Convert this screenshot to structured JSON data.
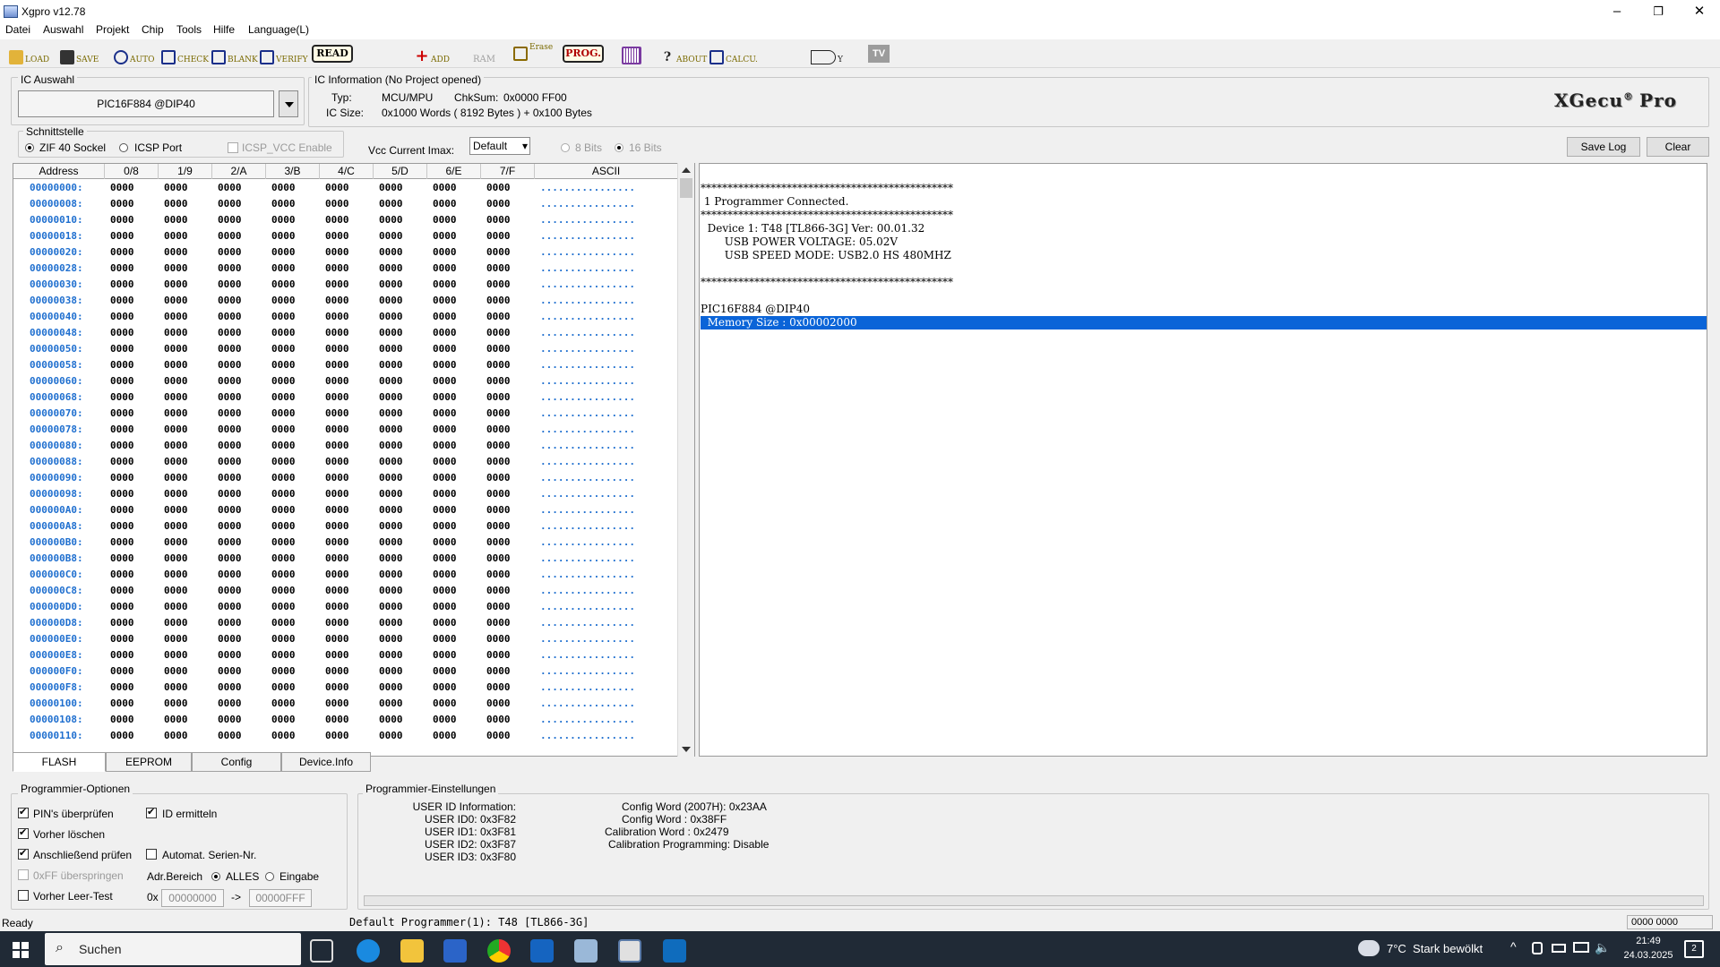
{
  "window": {
    "title": "Xgpro v12.78",
    "minimize": "–",
    "maximize": "❐",
    "close": "✕"
  },
  "menu": [
    "Datei",
    "Auswahl",
    "Projekt",
    "Chip",
    "Tools",
    "Hilfe",
    "Language(L)"
  ],
  "toolbar": {
    "load": "LOAD",
    "save": "SAVE",
    "auto": "AUTO",
    "check": "CHECK",
    "blank": "BLANK",
    "verify": "VERIFY",
    "read": "READ",
    "add": "ADD",
    "ram": "RAM",
    "erase": "Erase",
    "prog": "PROG.",
    "about": "ABOUT",
    "calcu": "CALCU.",
    "tv": "TV",
    "bxy": "Y"
  },
  "ic_auswahl": {
    "title": "IC Auswahl",
    "selected": "PIC16F884 @DIP40"
  },
  "ic_info": {
    "title": "IC Information (No Project opened)",
    "typ_label": "Typ:",
    "typ_value": "MCU/MPU",
    "chksum_label": "ChkSum:",
    "chksum_value": "0x0000 FF00",
    "size_label": "IC Size:",
    "size_value": "0x1000 Words ( 8192 Bytes ) + 0x100 Bytes"
  },
  "logo": {
    "text": "XGecu",
    "suffix": "Pro",
    "mark": "®"
  },
  "schnittstelle": {
    "title": "Schnittstelle",
    "zif": "ZIF 40 Sockel",
    "icsp": "ICSP Port",
    "icsp_vcc": "ICSP_VCC Enable"
  },
  "vcc": {
    "label": "Vcc Current Imax:",
    "value": "Default",
    "bits8": "8 Bits",
    "bits16": "16 Bits"
  },
  "log_buttons": {
    "save": "Save Log",
    "clear": "Clear"
  },
  "hex": {
    "headers": [
      "Address",
      "0/8",
      "1/9",
      "2/A",
      "3/B",
      "4/C",
      "5/D",
      "6/E",
      "7/F",
      "ASCII"
    ],
    "cell": "0000",
    "ascii": "................",
    "addresses": [
      "00000000:",
      "00000008:",
      "00000010:",
      "00000018:",
      "00000020:",
      "00000028:",
      "00000030:",
      "00000038:",
      "00000040:",
      "00000048:",
      "00000050:",
      "00000058:",
      "00000060:",
      "00000068:",
      "00000070:",
      "00000078:",
      "00000080:",
      "00000088:",
      "00000090:",
      "00000098:",
      "000000A0:",
      "000000A8:",
      "000000B0:",
      "000000B8:",
      "000000C0:",
      "000000C8:",
      "000000D0:",
      "000000D8:",
      "000000E0:",
      "000000E8:",
      "000000F0:",
      "000000F8:",
      "00000100:",
      "00000108:",
      "00000110:"
    ]
  },
  "log": [
    "***********************************************",
    " 1 Programmer Connected.",
    "***********************************************",
    "  Device 1: T48 [TL866-3G] Ver: 00.01.32",
    "       USB POWER VOLTAGE: 05.02V",
    "       USB SPEED MODE: USB2.0 HS 480MHZ",
    "",
    "***********************************************",
    "",
    "PIC16F884 @DIP40",
    "  Memory Size : 0x00002000"
  ],
  "tabs": [
    "FLASH",
    "EEPROM",
    "Config",
    "Device.Info"
  ],
  "prog_opts": {
    "title": "Programmier-Optionen",
    "pins": "PIN's überprüfen",
    "id": "ID ermitteln",
    "vorher_loeschen": "Vorher löschen",
    "anschl": "Anschließend prüfen",
    "serien": "Automat. Serien-Nr.",
    "skipff": "0xFF überspringen",
    "adr": "Adr.Bereich",
    "alles": "ALLES",
    "eingabe": "Eingabe",
    "leertest": "Vorher Leer-Test",
    "ox": "0x",
    "from": "00000000",
    "arrow": "->",
    "to": "00000FFF"
  },
  "prog_settings": {
    "title": "Programmier-Einstellungen",
    "left": [
      "USER ID Information:",
      "USER ID0: 0x3F82",
      "USER ID1: 0x3F81",
      "USER ID2: 0x3F87",
      "USER ID3: 0x3F80"
    ],
    "right": [
      "Config Word (2007H): 0x23AA",
      "Config Word : 0x38FF",
      "Calibration Word : 0x2479",
      "Calibration Programming: Disable"
    ]
  },
  "status": {
    "left": "Ready",
    "middle": "Default Programmer(1): T48 [TL866-3G]",
    "right": "0000 0000"
  },
  "taskbar": {
    "search": "Suchen",
    "weather": "7°C  Stark bewölkt",
    "time": "21:49",
    "date": "24.03.2025",
    "notif": "2"
  },
  "colors": {
    "accent_blue": "#1f6fcf",
    "selection": "#0a64d8",
    "taskbar": "#202a36"
  }
}
